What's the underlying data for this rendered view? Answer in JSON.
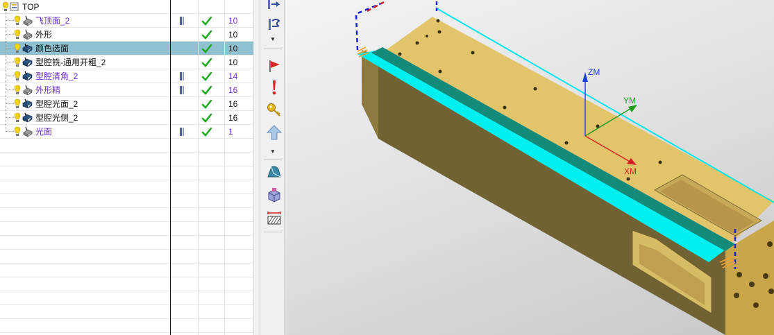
{
  "navigator": {
    "root": {
      "label": "TOP"
    },
    "operations": [
      {
        "name": "飞顶面_2",
        "tool": "10",
        "has_path": true,
        "status": "ok",
        "color": "purple",
        "icon": "face-mill-icon"
      },
      {
        "name": "外形",
        "tool": "10",
        "has_path": false,
        "status": "ok",
        "color": "black",
        "icon": "face-mill-icon"
      },
      {
        "name": "颜色选面",
        "tool": "10",
        "has_path": false,
        "status": "ok",
        "color": "black",
        "icon": "cavity-mill-icon",
        "selected": true
      },
      {
        "name": "型腔铣-通用开粗_2",
        "tool": "10",
        "has_path": false,
        "status": "ok",
        "color": "black",
        "icon": "cavity-mill-icon"
      },
      {
        "name": "型腔清角_2",
        "tool": "14",
        "has_path": true,
        "status": "ok",
        "color": "purple",
        "icon": "cavity-mill-icon"
      },
      {
        "name": "外形精",
        "tool": "16",
        "has_path": true,
        "status": "ok",
        "color": "purple",
        "icon": "face-mill-icon"
      },
      {
        "name": "型腔光面_2",
        "tool": "16",
        "has_path": false,
        "status": "ok",
        "color": "black",
        "icon": "cavity-mill-icon"
      },
      {
        "name": "型腔光侧_2",
        "tool": "16",
        "has_path": false,
        "status": "ok",
        "color": "black",
        "icon": "cavity-mill-icon"
      },
      {
        "name": "光面",
        "tool": "1",
        "has_path": true,
        "status": "ok",
        "color": "purple",
        "icon": "face-mill-icon"
      }
    ],
    "empty_rows": 14
  },
  "toolbar": {
    "buttons": [
      "output-icon",
      "postprocess-icon",
      "flag-icon",
      "exclamation-icon",
      "key-icon",
      "up-arrow-icon",
      "surface-icon",
      "3d-icon",
      "section-icon"
    ]
  },
  "viewport": {
    "axes": {
      "z": "ZM",
      "y": "YM",
      "x": "XM"
    },
    "colors": {
      "part_top": "#e2c56a",
      "part_side": "#716234",
      "highlight": "#00f0f0",
      "axis_z": "#1d3fd6",
      "axis_y": "#1e9a1e",
      "axis_x": "#d02020"
    }
  },
  "colors": {
    "selected_row": "#8fc1d1",
    "modified_text": "#6a2fc4",
    "check": "#21a821"
  }
}
